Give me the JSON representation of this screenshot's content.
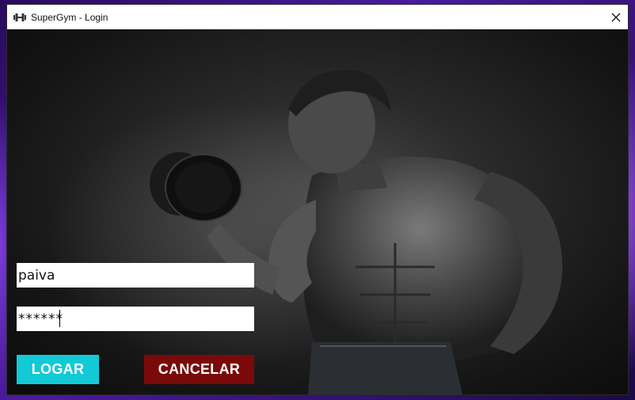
{
  "window": {
    "title": "SuperGym - Login",
    "app_icon": "dumbbell-icon",
    "close_icon": "close-icon"
  },
  "login": {
    "username_value": "paiva",
    "password_value": "******"
  },
  "buttons": {
    "login_label": "LOGAR",
    "cancel_label": "CANCELAR"
  },
  "colors": {
    "login_button": "#12c9d6",
    "cancel_button": "#7a0a0a",
    "titlebar": "#ffffff"
  }
}
